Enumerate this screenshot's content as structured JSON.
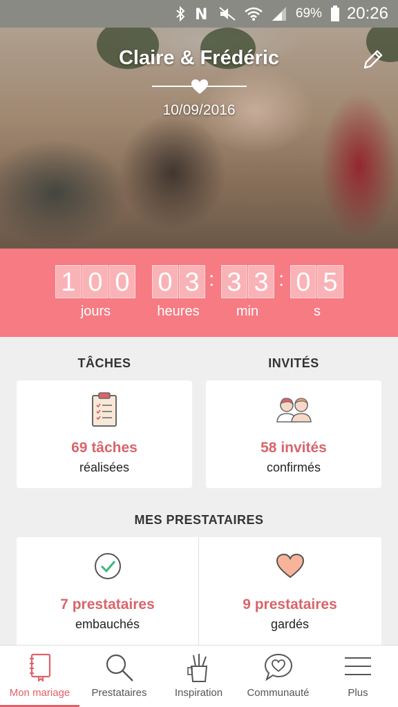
{
  "status_bar": {
    "battery_percent": "69%",
    "time": "20:26",
    "icons": [
      "bluetooth-icon",
      "nfc-icon",
      "mute-icon",
      "wifi-icon",
      "signal-icon",
      "battery-icon"
    ]
  },
  "hero": {
    "couple_names": "Claire & Frédéric",
    "wedding_date": "10/09/2016",
    "edit_icon": "pencil-icon"
  },
  "countdown": {
    "days": [
      "1",
      "0",
      "0"
    ],
    "hours": [
      "0",
      "3"
    ],
    "minutes": [
      "3",
      "3"
    ],
    "seconds": [
      "0",
      "5"
    ],
    "labels": {
      "days": "jours",
      "hours": "heures",
      "minutes": "min",
      "seconds": "s"
    },
    "accent_color": "#f67b83"
  },
  "tasks": {
    "heading": "TÂCHES",
    "count_text": "69 tâches",
    "status_text": "réalisées",
    "icon": "clipboard-icon"
  },
  "guests": {
    "heading": "INVITÉS",
    "count_text": "58 invités",
    "status_text": "confirmés",
    "icon": "guests-icon"
  },
  "vendors": {
    "heading": "MES PRESTATAIRES",
    "hired": {
      "count_text": "7 prestataires",
      "status_text": "embauchés",
      "icon": "check-circle-icon"
    },
    "saved": {
      "count_text": "9 prestataires",
      "status_text": "gardés",
      "icon": "heart-icon"
    }
  },
  "bottom_nav": {
    "items": [
      {
        "label": "Mon mariage",
        "icon": "notebook-icon",
        "active": true
      },
      {
        "label": "Prestataires",
        "icon": "search-icon",
        "active": false
      },
      {
        "label": "Inspiration",
        "icon": "pencil-cup-icon",
        "active": false
      },
      {
        "label": "Communauté",
        "icon": "chat-heart-icon",
        "active": false
      },
      {
        "label": "Plus",
        "icon": "menu-icon",
        "active": false
      }
    ],
    "active_color": "#e0606a"
  }
}
